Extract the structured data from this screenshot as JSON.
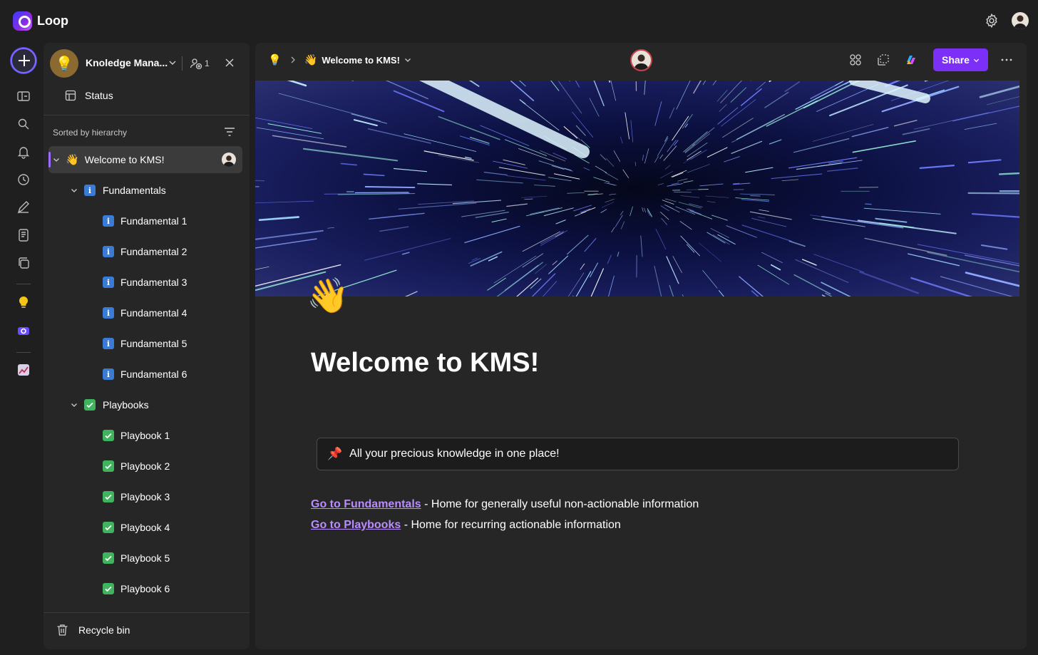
{
  "app": {
    "title": "Loop"
  },
  "colors": {
    "accent": "#7b2ff7",
    "link": "#b98cff",
    "info": "#3a7bd5",
    "check": "#3fb35d"
  },
  "rail": {
    "icons": [
      "new-icon",
      "workspaces-icon",
      "search-icon",
      "bell-icon",
      "clock-icon",
      "ideas-icon",
      "notes-icon",
      "components-icon",
      "bulb-workspace-icon",
      "loop-workspace-icon",
      "chart-workspace-icon"
    ]
  },
  "sidebar": {
    "workspace_name": "Knoledge Mana...",
    "member_count": "1",
    "status_label": "Status",
    "sorted_label": "Sorted by hierarchy",
    "tree": {
      "root": {
        "emoji": "👋",
        "label": "Welcome to KMS!"
      },
      "fundamentals": {
        "label": "Fundamentals",
        "items": [
          "Fundamental 1",
          "Fundamental 2",
          "Fundamental 3",
          "Fundamental 4",
          "Fundamental 5",
          "Fundamental 6"
        ]
      },
      "playbooks": {
        "label": "Playbooks",
        "items": [
          "Playbook 1",
          "Playbook 2",
          "Playbook 3",
          "Playbook 4",
          "Playbook 5",
          "Playbook 6"
        ]
      }
    },
    "recycle_label": "Recycle bin"
  },
  "page": {
    "breadcrumb_emoji": "👋",
    "breadcrumb_title": "Welcome to KMS!",
    "share_label": "Share",
    "emoji": "👋",
    "title": "Welcome to KMS!",
    "callout_emoji": "📌",
    "callout_text": "All your precious knowledge in one place!",
    "links": [
      {
        "link_text": "Go to Fundamentals",
        "rest": " - Home for generally useful non-actionable information"
      },
      {
        "link_text": "Go to Playbooks",
        "rest": " - Home for recurring actionable information"
      }
    ]
  }
}
